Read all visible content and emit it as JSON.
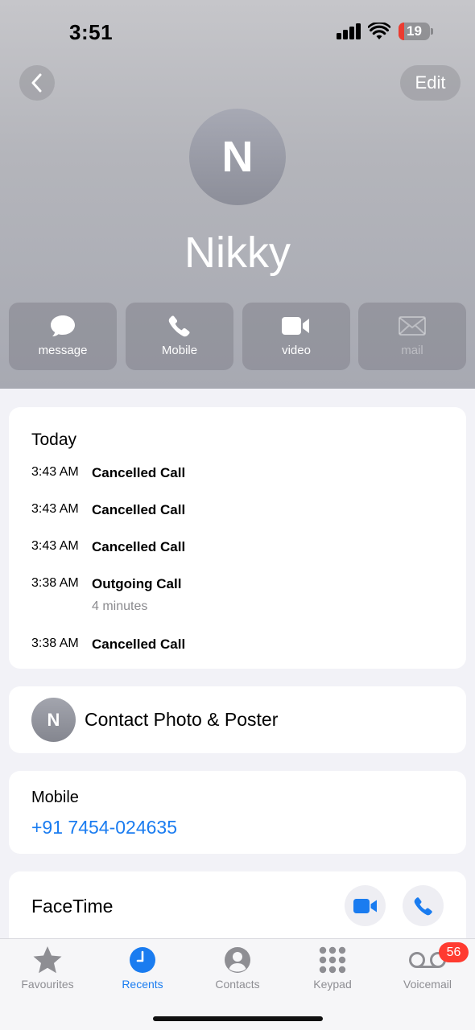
{
  "status_bar": {
    "time": "3:51",
    "battery_level": "19",
    "battery_fraction": 0.19
  },
  "nav": {
    "edit_label": "Edit"
  },
  "contact": {
    "initial": "N",
    "name": "Nikky"
  },
  "actions": [
    {
      "label": "message",
      "icon": "message-icon",
      "enabled": true
    },
    {
      "label": "Mobile",
      "icon": "phone-icon",
      "enabled": true
    },
    {
      "label": "video",
      "icon": "video-icon",
      "enabled": true
    },
    {
      "label": "mail",
      "icon": "mail-icon",
      "enabled": false
    }
  ],
  "recents": {
    "title": "Today",
    "calls": [
      {
        "time": "3:43 AM",
        "type": "Cancelled Call"
      },
      {
        "time": "3:43 AM",
        "type": "Cancelled Call"
      },
      {
        "time": "3:43 AM",
        "type": "Cancelled Call"
      },
      {
        "time": "3:38 AM",
        "type": "Outgoing Call",
        "duration": "4 minutes"
      },
      {
        "time": "3:38 AM",
        "type": "Cancelled Call"
      }
    ]
  },
  "poster": {
    "initial": "N",
    "label": "Contact Photo & Poster"
  },
  "phone": {
    "label": "Mobile",
    "number": "+91 7454-024635"
  },
  "facetime": {
    "label": "FaceTime"
  },
  "tabs": [
    {
      "label": "Favourites",
      "icon": "star-icon",
      "active": false
    },
    {
      "label": "Recents",
      "icon": "clock-icon",
      "active": true
    },
    {
      "label": "Contacts",
      "icon": "person-icon",
      "active": false
    },
    {
      "label": "Keypad",
      "icon": "keypad-icon",
      "active": false
    },
    {
      "label": "Voicemail",
      "icon": "voicemail-icon",
      "active": false,
      "badge": "56"
    }
  ],
  "colors": {
    "accent": "#1a7cf0",
    "badge": "#ff3b30",
    "battery_low": "#eb3b30"
  }
}
